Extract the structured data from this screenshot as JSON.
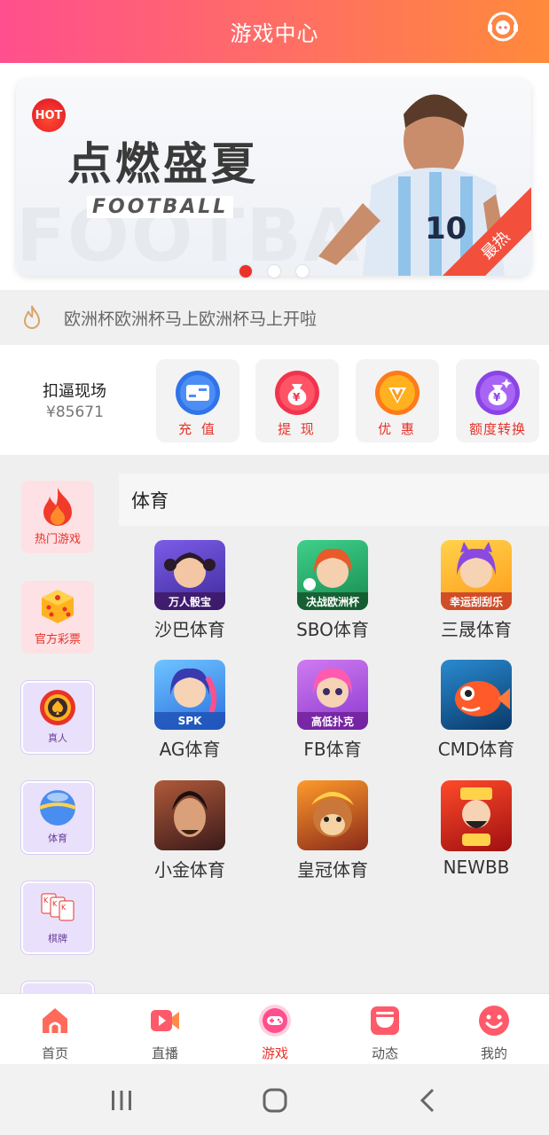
{
  "header": {
    "title": "游戏中心"
  },
  "banner": {
    "hot_badge": "HOT",
    "title": "点燃盛夏",
    "subtitle": "FOOTBALL",
    "bg_text": "FOOTBALL",
    "corner_label": "最热",
    "page_count": 3,
    "active_page": 1
  },
  "marquee": {
    "text": "欧洲杯欧洲杯马上欧洲杯马上开啦"
  },
  "wallet": {
    "label": "扣逼现场",
    "amount": "¥85671"
  },
  "actions": [
    {
      "label": "充 值",
      "icon": "card-icon"
    },
    {
      "label": "提 现",
      "icon": "money-bag-icon"
    },
    {
      "label": "优 惠",
      "icon": "vip-diamond-icon"
    },
    {
      "label": "额度转换",
      "icon": "exchange-bag-icon"
    }
  ],
  "categories": [
    {
      "label": "热门游戏",
      "icon": "flame-icon",
      "style": "red"
    },
    {
      "label": "官方彩票",
      "icon": "dice-icon",
      "style": "red"
    },
    {
      "label": "真人",
      "icon": "poker-chip-icon",
      "style": "purple"
    },
    {
      "label": "体育",
      "icon": "ball-icon",
      "style": "purple"
    },
    {
      "label": "棋牌",
      "icon": "cards-icon",
      "style": "purple"
    }
  ],
  "section": {
    "title": "体育"
  },
  "games": [
    {
      "name": "沙巴体育",
      "caption": "万人骰宝"
    },
    {
      "name": "SBO体育",
      "caption": "决战欧洲杯"
    },
    {
      "name": "三晟体育",
      "caption": "幸运刮刮乐"
    },
    {
      "name": "AG体育",
      "caption": "SPK"
    },
    {
      "name": "FB体育",
      "caption": "高低扑克"
    },
    {
      "name": "CMD体育",
      "caption": ""
    },
    {
      "name": "小金体育",
      "caption": ""
    },
    {
      "name": "皇冠体育",
      "caption": ""
    },
    {
      "name": "NEWBB",
      "caption": ""
    }
  ],
  "tabs": [
    {
      "label": "首页",
      "icon": "home-icon",
      "active": false
    },
    {
      "label": "直播",
      "icon": "video-icon",
      "active": false
    },
    {
      "label": "游戏",
      "icon": "gamepad-icon",
      "active": true
    },
    {
      "label": "动态",
      "icon": "moments-icon",
      "active": false
    },
    {
      "label": "我的",
      "icon": "smile-icon",
      "active": false
    }
  ],
  "colors": {
    "accent": "#e8322a",
    "header_start": "#ff4f8e",
    "header_end": "#ff8a3a"
  }
}
